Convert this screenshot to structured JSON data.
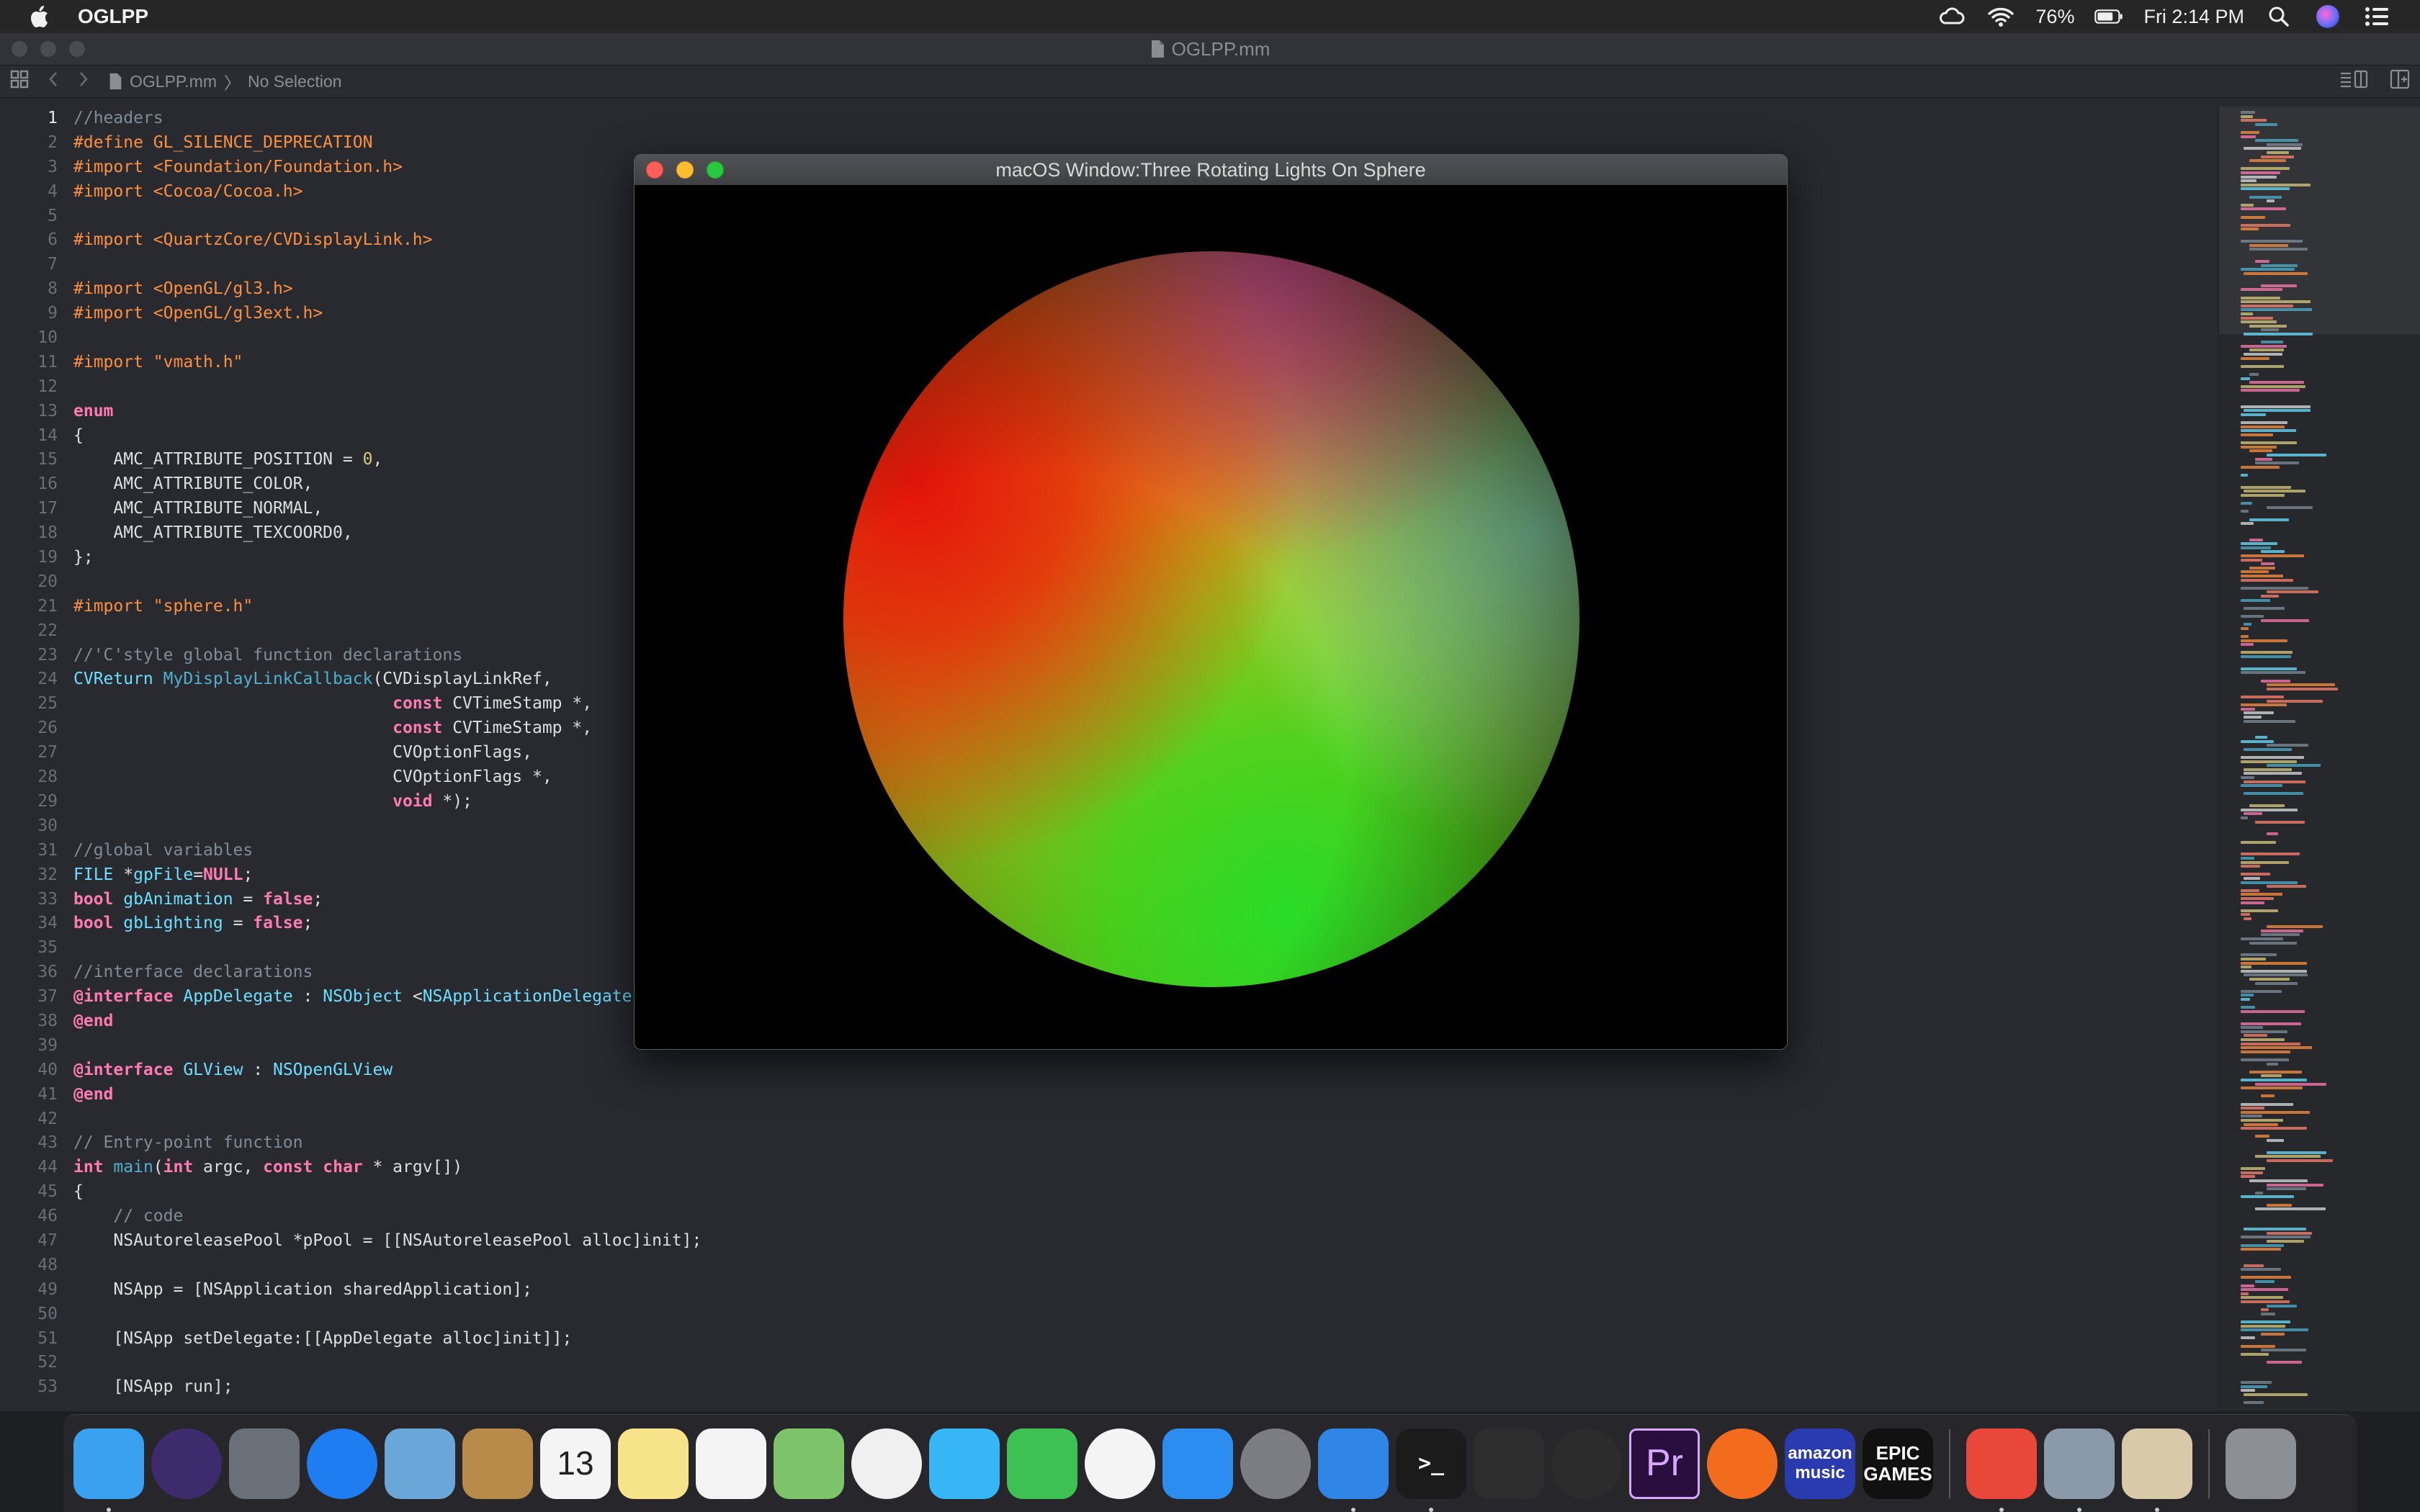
{
  "menubar": {
    "app_name": "OGLPP",
    "battery": "76%",
    "clock": "Fri 2:14 PM",
    "icons": [
      "apple-icon",
      "creative-cloud-icon",
      "wifi-icon",
      "battery-icon",
      "search-icon",
      "siri-icon",
      "control-center-icon"
    ]
  },
  "xcode": {
    "window_title": "OGLPP.mm",
    "jumpbar": {
      "file": "OGLPP.mm",
      "selection": "No Selection"
    }
  },
  "editor": {
    "current_line": 1,
    "lines": [
      [
        [
          "c-cm",
          "//headers"
        ]
      ],
      [
        [
          "c-pp",
          "#define GL_SILENCE_DEPRECATION"
        ]
      ],
      [
        [
          "c-pp",
          "#import <Foundation/Foundation.h>"
        ]
      ],
      [
        [
          "c-pp",
          "#import <Cocoa/Cocoa.h>"
        ]
      ],
      [],
      [
        [
          "c-pp",
          "#import <QuartzCore/CVDisplayLink.h>"
        ]
      ],
      [],
      [
        [
          "c-pp",
          "#import <OpenGL/gl3.h>"
        ]
      ],
      [
        [
          "c-pp",
          "#import <OpenGL/gl3ext.h>"
        ]
      ],
      [],
      [
        [
          "c-pp",
          "#import \"vmath.h\""
        ]
      ],
      [],
      [
        [
          "c-kw",
          "enum"
        ]
      ],
      [
        [
          "",
          "{"
        ]
      ],
      [
        [
          "",
          "    AMC_ATTRIBUTE_POSITION = "
        ],
        [
          "c-nm",
          "0"
        ],
        [
          "",
          ","
        ]
      ],
      [
        [
          "",
          "    AMC_ATTRIBUTE_COLOR,"
        ]
      ],
      [
        [
          "",
          "    AMC_ATTRIBUTE_NORMAL,"
        ]
      ],
      [
        [
          "",
          "    AMC_ATTRIBUTE_TEXCOORD0,"
        ]
      ],
      [
        [
          "",
          "};"
        ]
      ],
      [],
      [
        [
          "c-pp",
          "#import \"sphere.h\""
        ]
      ],
      [],
      [
        [
          "c-cm",
          "//'C'style global function declarations"
        ]
      ],
      [
        [
          "c-ty",
          "CVReturn"
        ],
        [
          "",
          " "
        ],
        [
          "c-fn",
          "MyDisplayLinkCallback"
        ],
        [
          "",
          "(CVDisplayLinkRef,"
        ]
      ],
      [
        [
          "",
          "                                "
        ],
        [
          "c-kw",
          "const"
        ],
        [
          "",
          " CVTimeStamp *,"
        ]
      ],
      [
        [
          "",
          "                                "
        ],
        [
          "c-kw",
          "const"
        ],
        [
          "",
          " CVTimeStamp *,"
        ]
      ],
      [
        [
          "",
          "                                CVOptionFlags,"
        ]
      ],
      [
        [
          "",
          "                                CVOptionFlags *,"
        ]
      ],
      [
        [
          "",
          "                                "
        ],
        [
          "c-kw",
          "void"
        ],
        [
          "",
          " *);"
        ]
      ],
      [],
      [
        [
          "c-cm",
          "//global variables"
        ]
      ],
      [
        [
          "c-ty",
          "FILE"
        ],
        [
          "",
          " *"
        ],
        [
          "c-ty",
          "gpFile"
        ],
        [
          "",
          "="
        ],
        [
          "c-kw",
          "NULL"
        ],
        [
          "",
          ";"
        ]
      ],
      [
        [
          "c-kw",
          "bool"
        ],
        [
          "",
          " "
        ],
        [
          "c-ty",
          "gbAnimation"
        ],
        [
          "",
          " = "
        ],
        [
          "c-kw",
          "false"
        ],
        [
          "",
          ";"
        ]
      ],
      [
        [
          "c-kw",
          "bool"
        ],
        [
          "",
          " "
        ],
        [
          "c-ty",
          "gbLighting"
        ],
        [
          "",
          " = "
        ],
        [
          "c-kw",
          "false"
        ],
        [
          "",
          ";"
        ]
      ],
      [],
      [
        [
          "c-cm",
          "//interface declarations"
        ]
      ],
      [
        [
          "c-kw",
          "@interface"
        ],
        [
          "",
          " "
        ],
        [
          "c-ty",
          "AppDelegate"
        ],
        [
          "",
          " : "
        ],
        [
          "c-ty",
          "NSObject"
        ],
        [
          "",
          " <"
        ],
        [
          "c-ty",
          "NSApplicationDelegate"
        ]
      ],
      [
        [
          "c-kw",
          "@end"
        ]
      ],
      [],
      [
        [
          "c-kw",
          "@interface"
        ],
        [
          "",
          " "
        ],
        [
          "c-ty",
          "GLView"
        ],
        [
          "",
          " : "
        ],
        [
          "c-ty",
          "NSOpenGLView"
        ]
      ],
      [
        [
          "c-kw",
          "@end"
        ]
      ],
      [],
      [
        [
          "c-cm",
          "// Entry-point function"
        ]
      ],
      [
        [
          "c-kw",
          "int"
        ],
        [
          "",
          " "
        ],
        [
          "c-fn",
          "main"
        ],
        [
          "",
          "("
        ],
        [
          "c-kw",
          "int"
        ],
        [
          "",
          " argc, "
        ],
        [
          "c-kw",
          "const"
        ],
        [
          "",
          " "
        ],
        [
          "c-kw",
          "char"
        ],
        [
          "",
          " * argv[])"
        ]
      ],
      [
        [
          "",
          "{"
        ]
      ],
      [
        [
          "c-cm",
          "    // code"
        ]
      ],
      [
        [
          "",
          "    NSAutoreleasePool *pPool = [[NSAutoreleasePool alloc]init];"
        ]
      ],
      [],
      [
        [
          "",
          "    NSApp = [NSApplication sharedApplication];"
        ]
      ],
      [],
      [
        [
          "",
          "    [NSApp setDelegate:[[AppDelegate alloc]init]];"
        ]
      ],
      [],
      [
        [
          "",
          "    [NSApp run];"
        ]
      ]
    ]
  },
  "gl_window": {
    "title": "macOS Window:Three Rotating Lights On Sphere"
  },
  "dock": {
    "items": [
      {
        "name": "finder",
        "label": "",
        "color": "#3aa0f0",
        "running": true
      },
      {
        "name": "siri",
        "label": "",
        "color": "#3d2b6e",
        "running": false
      },
      {
        "name": "launchpad",
        "label": "",
        "color": "#6a6f78",
        "running": false
      },
      {
        "name": "safari",
        "label": "",
        "color": "#1e7df0",
        "running": false
      },
      {
        "name": "mail",
        "label": "",
        "color": "#6aa6d8",
        "running": false
      },
      {
        "name": "contacts",
        "label": "",
        "color": "#b88b4a",
        "running": false
      },
      {
        "name": "calendar",
        "label": "13",
        "color": "#f4f4f4",
        "running": false
      },
      {
        "name": "notes",
        "label": "",
        "color": "#f7e38a",
        "running": false
      },
      {
        "name": "reminders",
        "label": "",
        "color": "#f4f4f4",
        "running": false
      },
      {
        "name": "maps",
        "label": "",
        "color": "#7cc36a",
        "running": false
      },
      {
        "name": "photos",
        "label": "",
        "color": "#f0f0f0",
        "running": false
      },
      {
        "name": "messages",
        "label": "",
        "color": "#36b6f4",
        "running": false
      },
      {
        "name": "facetime",
        "label": "",
        "color": "#3dc153",
        "running": false
      },
      {
        "name": "music",
        "label": "",
        "color": "#f4f4f4",
        "running": false
      },
      {
        "name": "app-store",
        "label": "",
        "color": "#2b8df0",
        "running": false
      },
      {
        "name": "system-preferences",
        "label": "",
        "color": "#7b7d82",
        "running": false
      },
      {
        "name": "xcode",
        "label": "",
        "color": "#2f86e6",
        "running": true
      },
      {
        "name": "terminal",
        "label": ">_",
        "color": "#1b1b1b",
        "running": true
      },
      {
        "name": "final-cut-pro",
        "label": "",
        "color": "#2d2d2d",
        "running": false
      },
      {
        "name": "logic-pro",
        "label": "",
        "color": "#2c2c2c",
        "running": false
      },
      {
        "name": "premiere-pro",
        "label": "Pr",
        "color": "#2a0e3e",
        "running": false
      },
      {
        "name": "firefox",
        "label": "",
        "color": "#f36b1c",
        "running": false
      },
      {
        "name": "amazon-music",
        "label": "amazon music",
        "color": "#2a3bb0",
        "running": false
      },
      {
        "name": "epic-games",
        "label": "EPIC GAMES",
        "color": "#111111",
        "running": false
      },
      {
        "name": "anydesk",
        "label": "",
        "color": "#e8473a",
        "running": true
      },
      {
        "name": "preview",
        "label": "",
        "color": "#8a9aaa",
        "running": true
      },
      {
        "name": "textedit",
        "label": "",
        "color": "#d8c9a8",
        "running": true
      },
      {
        "name": "trash",
        "label": "",
        "color": "#8c9096",
        "running": false
      }
    ]
  }
}
